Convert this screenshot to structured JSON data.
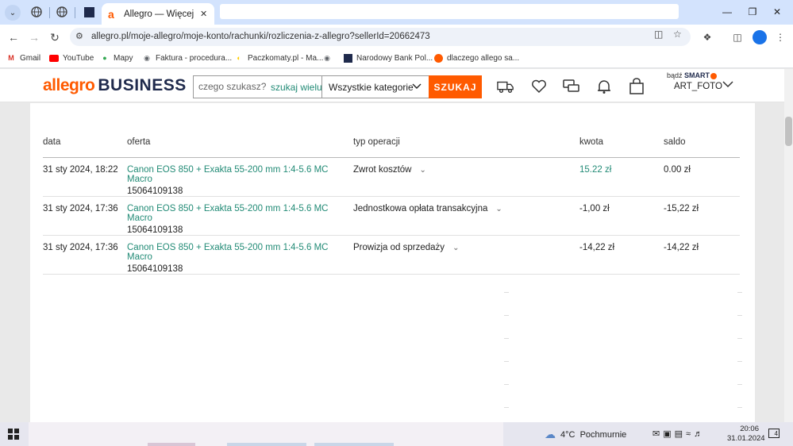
{
  "browser": {
    "active_tab_title": "Allegro — Więcej niż a",
    "url": "allegro.pl/moje-allegro/moje-konto/rachunki/rozliczenia-z-allegro?sellerId=20662473",
    "bookmarks": [
      {
        "label": "Gmail",
        "icon": "gmail-icon",
        "color": "#d93025"
      },
      {
        "label": "YouTube",
        "icon": "youtube-icon",
        "color": "#ff0000"
      },
      {
        "label": "Mapy",
        "icon": "maps-icon",
        "color": "#34a853"
      },
      {
        "label": "Faktura - procedura...",
        "icon": "globe-icon",
        "color": "#5f6368"
      },
      {
        "label": "Paczkomaty.pl - Ma...",
        "icon": "paczkomaty-icon",
        "color": "#ffcd00"
      },
      {
        "label": "",
        "icon": "globe-icon",
        "color": "#5f6368"
      },
      {
        "label": "Narodowy Bank Pol...",
        "icon": "nbp-icon",
        "color": "#1f2a4c"
      },
      {
        "label": "dlaczego allego sa...",
        "icon": "allegro-icon",
        "color": "#ff5a00"
      }
    ]
  },
  "header": {
    "logo_main": "allegro",
    "logo_sub": "BUSINESS",
    "search_placeholder": "czego szukasz?",
    "search_multi": "szukaj wielu",
    "category": "Wszystkie kategorie",
    "search_button": "SZUKAJ",
    "smart_prefix": "bądź",
    "smart_label": "SMART",
    "account_name": "ART_FOTO",
    "accent_color": "#ff5a00"
  },
  "table": {
    "headers": {
      "date": "data",
      "offer": "oferta",
      "type": "typ operacji",
      "amount": "kwota",
      "balance": "saldo"
    },
    "rows": [
      {
        "date": "31 sty 2024, 18:22",
        "offer": "Canon EOS 850 + Exakta 55-200 mm 1:4-5.6 MC Macro",
        "offer_id": "15064109138",
        "type": "Zwrot kosztów",
        "amount": "15.22 zł",
        "amount_positive": true,
        "balance": "0.00 zł"
      },
      {
        "date": "31 sty 2024, 17:36",
        "offer": "Canon EOS 850 + Exakta 55-200 mm 1:4-5.6 MC Macro",
        "offer_id": "15064109138",
        "type": "Jednostkowa opłata transakcyjna",
        "amount": "-1,00 zł",
        "amount_positive": false,
        "balance": "-15,22 zł"
      },
      {
        "date": "31 sty 2024, 17:36",
        "offer": "Canon EOS 850 + Exakta 55-200 mm 1:4-5.6 MC Macro",
        "offer_id": "15064109138",
        "type": "Prowizja od sprzedaży",
        "amount": "-14,22 zł",
        "amount_positive": false,
        "balance": "-14,22 zł"
      }
    ]
  },
  "taskbar": {
    "weather_temp": "4°C",
    "weather_desc": "Pochmurnie",
    "time": "20:06",
    "date": "31.01.2024",
    "notifications": "4"
  }
}
